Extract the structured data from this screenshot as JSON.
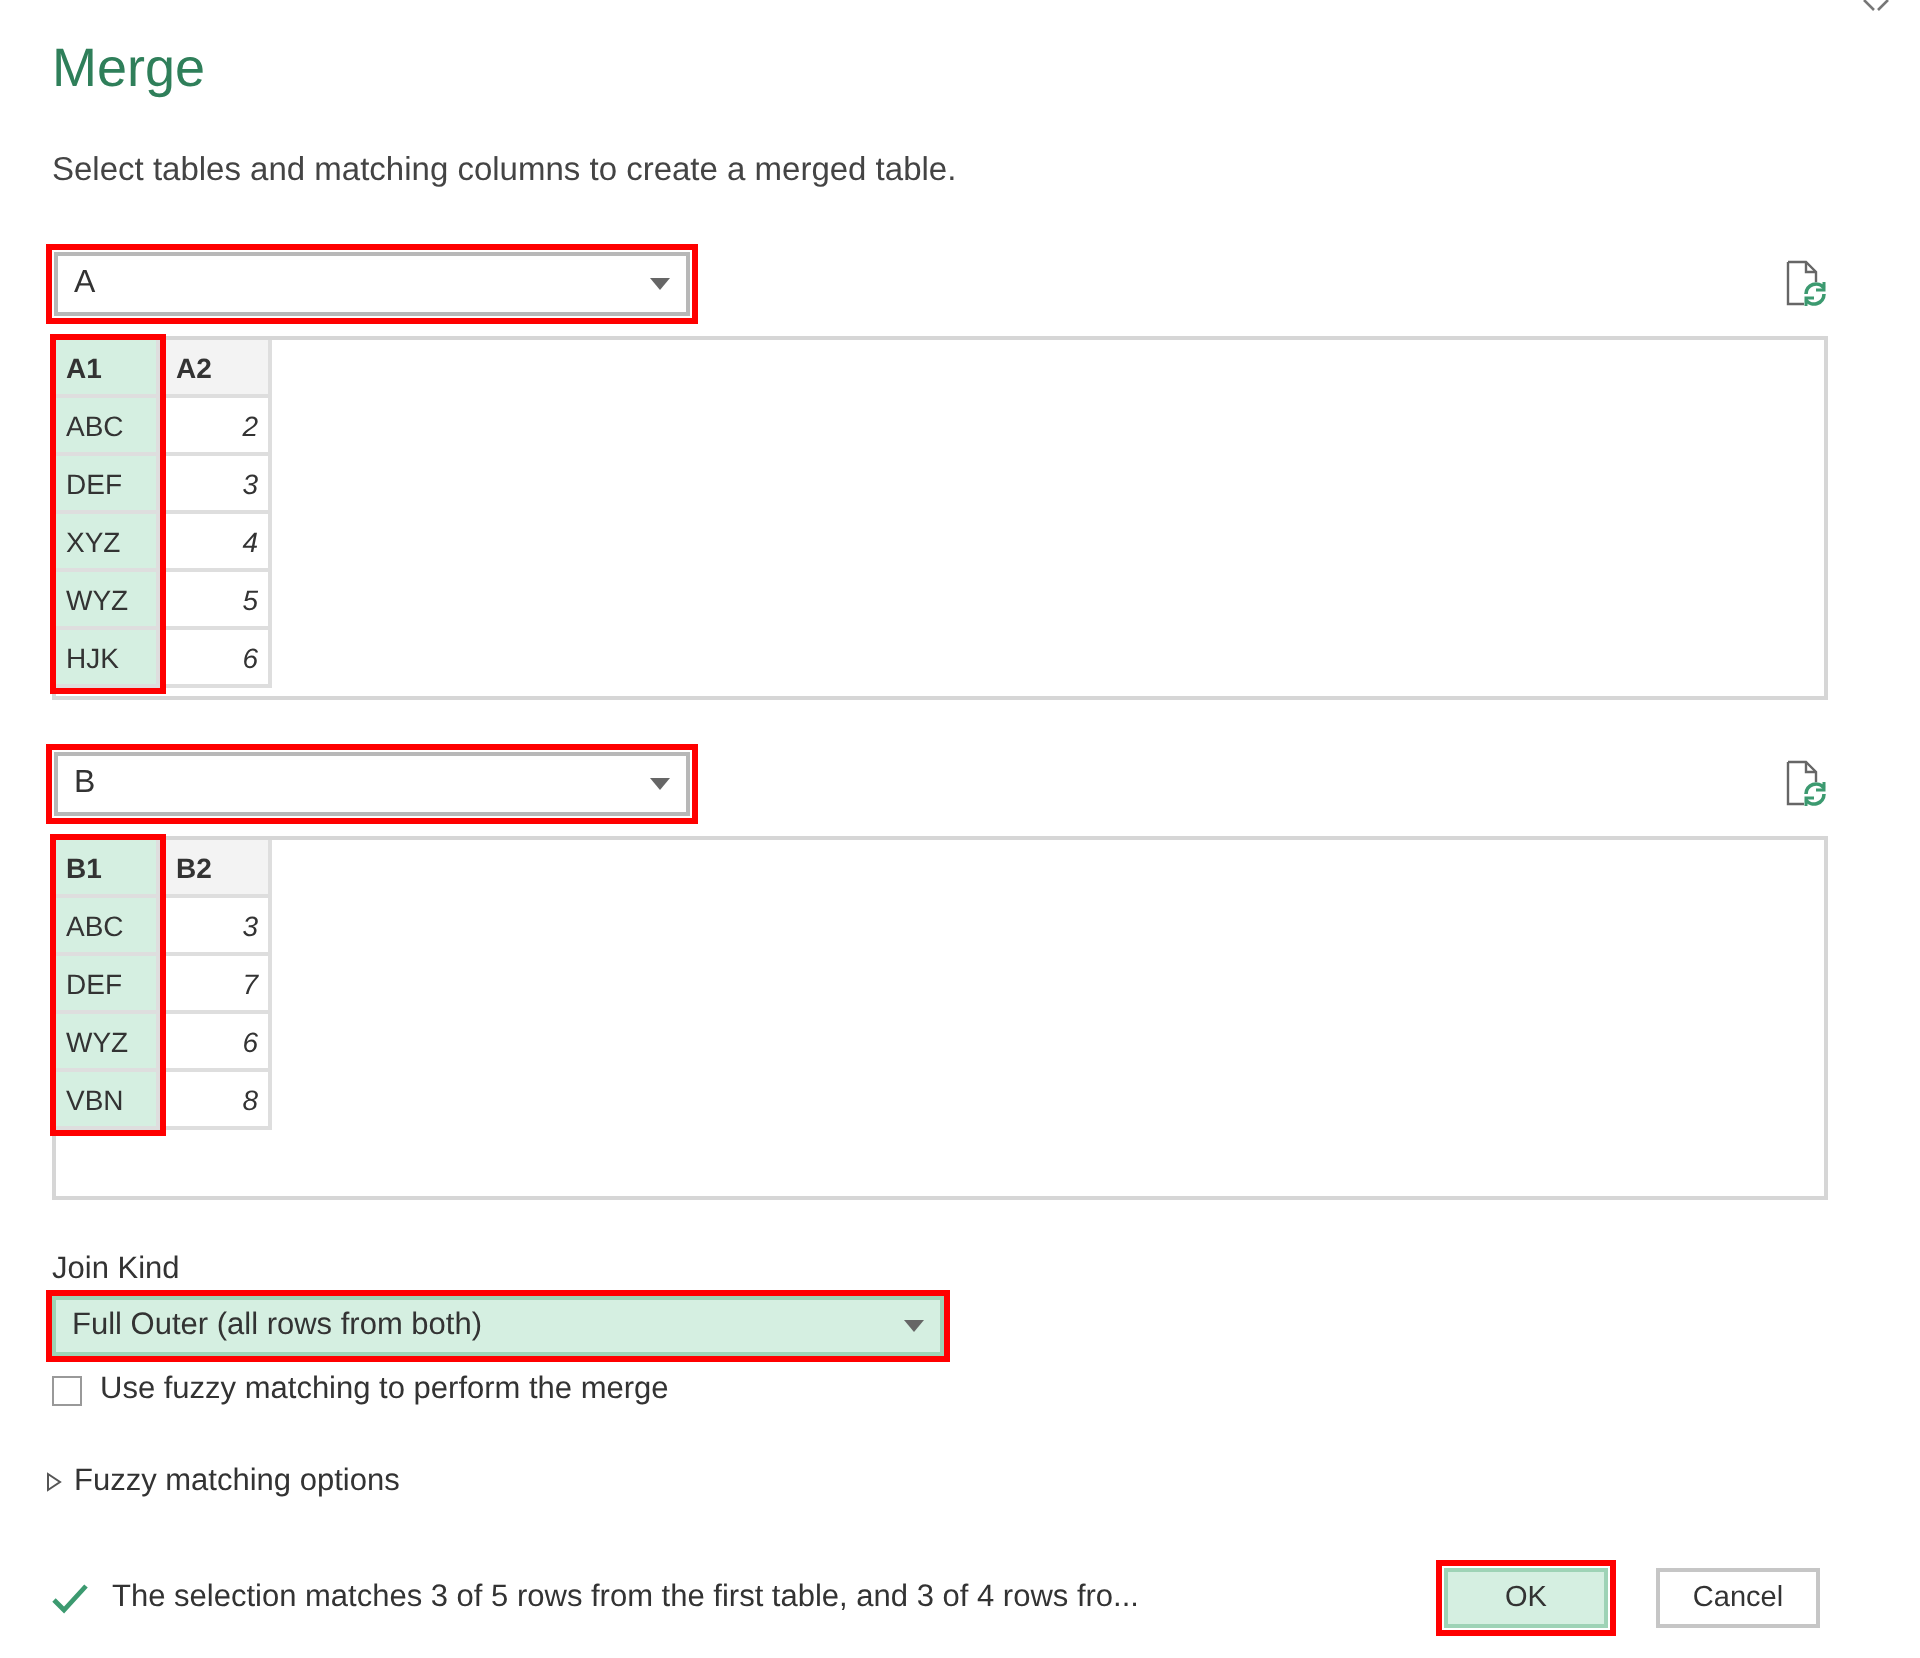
{
  "dialog": {
    "title": "Merge",
    "subtitle": "Select tables and matching columns to create a merged table."
  },
  "tables": [
    {
      "selection": "A",
      "highlighted": true,
      "columns": [
        {
          "header": "A1",
          "kind": "text",
          "selected": true,
          "highlighted": true,
          "cells": [
            "ABC",
            "DEF",
            "XYZ",
            "WYZ",
            "HJK"
          ]
        },
        {
          "header": "A2",
          "kind": "number",
          "selected": false,
          "highlighted": false,
          "cells": [
            "2",
            "3",
            "4",
            "5",
            "6"
          ]
        }
      ]
    },
    {
      "selection": "B",
      "highlighted": true,
      "columns": [
        {
          "header": "B1",
          "kind": "text",
          "selected": true,
          "highlighted": true,
          "cells": [
            "ABC",
            "DEF",
            "WYZ",
            "VBN"
          ]
        },
        {
          "header": "B2",
          "kind": "number",
          "selected": false,
          "highlighted": false,
          "cells": [
            "3",
            "7",
            "6",
            "8"
          ]
        }
      ]
    }
  ],
  "join": {
    "label": "Join Kind",
    "value": "Full Outer (all rows from both)",
    "highlighted": true
  },
  "fuzzy": {
    "label": "Use fuzzy matching to perform the merge",
    "checked": false
  },
  "fuzzy_options": {
    "label": "Fuzzy matching options",
    "expanded": false
  },
  "status": {
    "text": "The selection matches 3 of 5 rows from the first table, and 3 of 4 rows fro..."
  },
  "buttons": [
    {
      "label": "OK",
      "kind": "primary",
      "highlighted": true
    },
    {
      "label": "Cancel",
      "kind": "secondary",
      "highlighted": false
    }
  ]
}
